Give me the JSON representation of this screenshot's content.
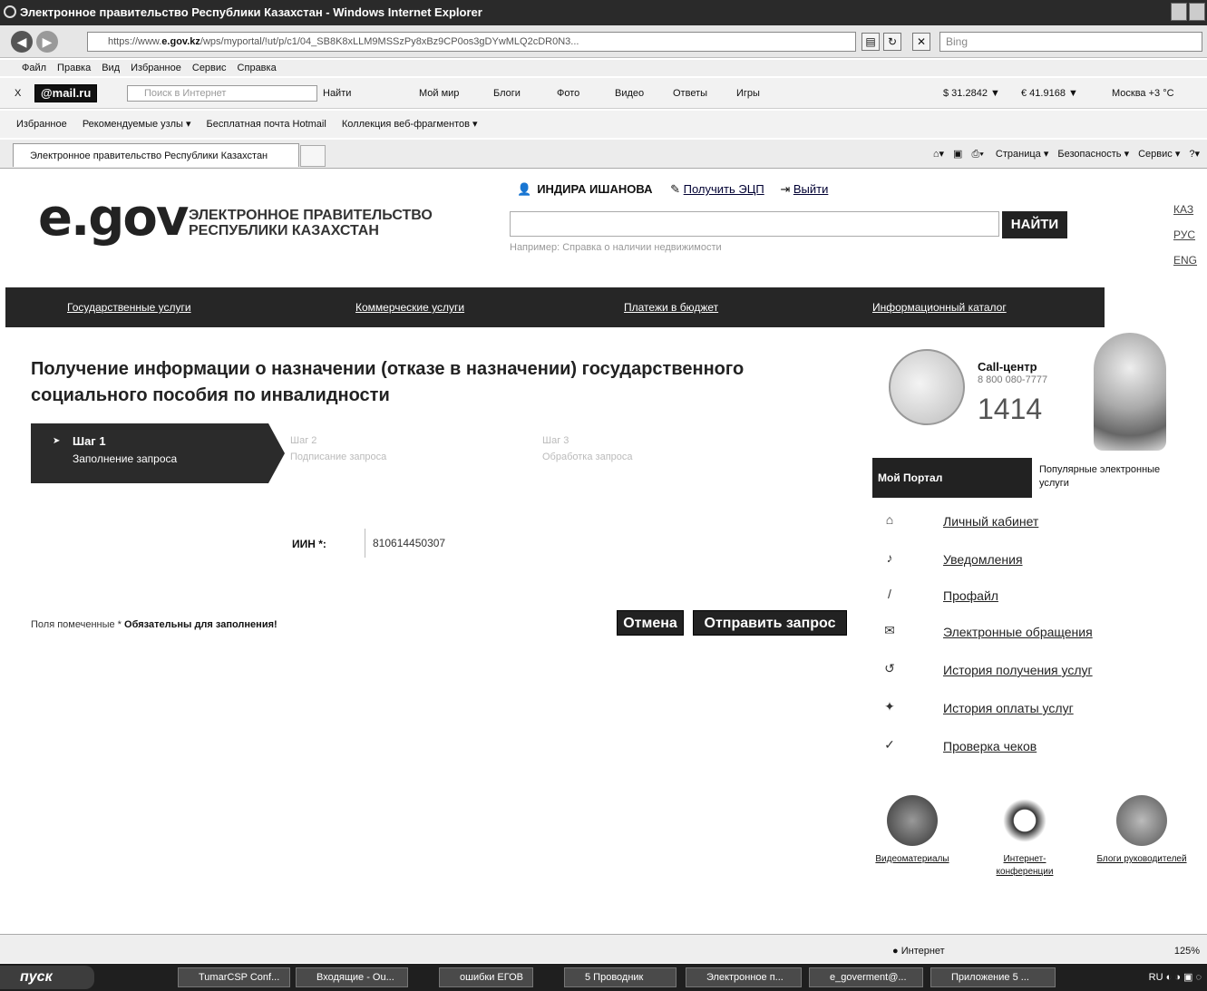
{
  "window": {
    "title": "Электронное правительство Республики Казахстан - Windows Internet Explorer"
  },
  "address": {
    "url_prefix": "https://www.",
    "url_domain": "e.gov.kz",
    "url_rest": "/wps/myportal/!ut/p/c1/04_SB8K8xLLM9MSSzPy8xBz9CP0os3gDYwMLQ2cDR0N3...",
    "search_placeholder": "Bing"
  },
  "menubar": [
    "Файл",
    "Правка",
    "Вид",
    "Избранное",
    "Сервис",
    "Справка"
  ],
  "mailbar": {
    "logo": "@mail.ru",
    "search_placeholder": "Поиск в Интернет",
    "find": "Найти",
    "items": [
      "Мой мир",
      "Блоги",
      "Фото",
      "Видео",
      "Ответы",
      "Игры"
    ],
    "usd": "$ 31.2842 ▼",
    "eur": "€ 41.9168 ▼",
    "weather": "Москва +3 °C"
  },
  "favbar": {
    "label": "Избранное",
    "item1": "Рекомендуемые узлы ▾",
    "item2": "Бесплатная почта Hotmail",
    "item3": "Коллекция веб-фрагментов ▾"
  },
  "tab": {
    "label": "Электронное правительство Республики Казахстан"
  },
  "cmdbar": [
    "Страница ▾",
    "Безопасность ▾",
    "Сервис ▾"
  ],
  "header": {
    "logo": "e.gov",
    "logo_line1": "ЭЛЕКТРОННОЕ ПРАВИТЕЛЬСТВО",
    "logo_line2": "РЕСПУБЛИКИ КАЗАХСТАН",
    "user_name": "ИНДИРА ИШАНОВА",
    "get_ecp": "Получить ЭЦП",
    "logout": "Выйти",
    "search_button": "НАЙТИ",
    "search_hint": "Например: Справка о наличии недвижимости",
    "langs": [
      "КАЗ",
      "РУС",
      "ENG"
    ]
  },
  "nav": [
    "Государственные услуги",
    "Коммерческие услуги",
    "Платежи в бюджет",
    "Информационный каталог"
  ],
  "main": {
    "title": "Получение информации о назначении (отказе в назначении) государственного социального пособия по инвалидности",
    "step1_title": "Шаг 1",
    "step1_sub": "Заполнение запроса",
    "step2_title": "Шаг 2",
    "step2_sub": "Подписание запроса",
    "step3_title": "Шаг 3",
    "step3_sub": "Обработка запроса",
    "iin_label": "ИИН *:",
    "iin_value": "810614450307",
    "required_note": "Поля помеченные * ",
    "required_bold": "Обязательны для заполнения!",
    "cancel": "Отмена",
    "submit": "Отправить запрос"
  },
  "sidebar": {
    "call_title": "Call-центр",
    "call_number": "8 800 080-7777",
    "call_short": "1414",
    "tab_my": "Мой Портал",
    "tab_popular": "Популярные электронные услуги",
    "links": [
      "Личный кабинет",
      "Уведомления",
      "Профайл",
      "Электронные обращения",
      "История получения услуг",
      "История оплаты услуг",
      "Проверка чеков"
    ],
    "media": [
      "Видеоматериалы",
      "Интернет-конференции",
      "Блоги руководителей"
    ]
  },
  "status": {
    "zone": "Интернет",
    "zoom": "125%"
  },
  "taskbar": {
    "start": "пуск",
    "buttons": [
      "TumarCSP Conf...",
      "Входящие - Ou...",
      "ошибки ЕГОВ",
      "5 Проводник",
      "Электронное п...",
      "e_goverment@...",
      "Приложение 5 ..."
    ],
    "lang": "RU"
  }
}
